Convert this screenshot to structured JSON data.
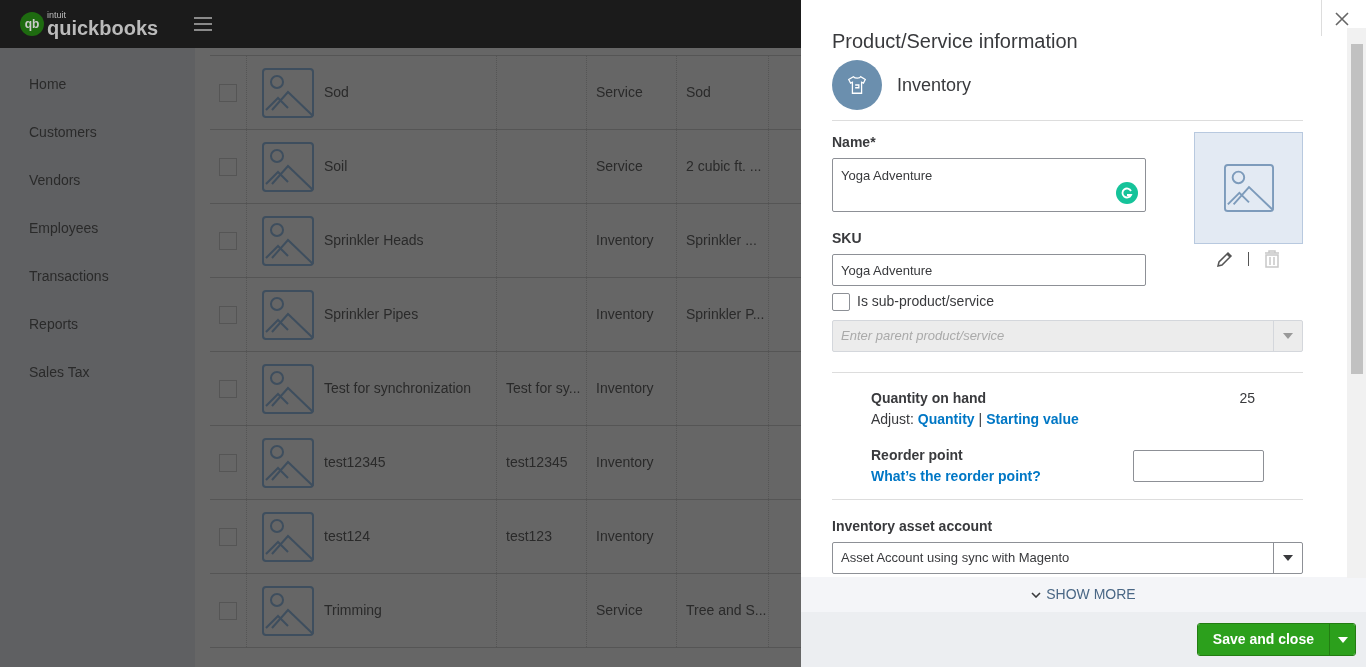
{
  "logo": {
    "mark": "qb",
    "small": "intuit",
    "name": "quickbooks"
  },
  "sidebar": {
    "items": [
      {
        "label": "Home"
      },
      {
        "label": "Customers"
      },
      {
        "label": "Vendors"
      },
      {
        "label": "Employees"
      },
      {
        "label": "Transactions"
      },
      {
        "label": "Reports"
      },
      {
        "label": "Sales Tax"
      }
    ]
  },
  "table": {
    "rows": [
      {
        "checked": false,
        "name": "Sod",
        "sku": "",
        "type": "Service",
        "description": "Sod"
      },
      {
        "checked": false,
        "name": "Soil",
        "sku": "",
        "type": "Service",
        "description": "2 cubic ft. ..."
      },
      {
        "checked": false,
        "name": "Sprinkler Heads",
        "sku": "",
        "type": "Inventory",
        "description": "Sprinkler ..."
      },
      {
        "checked": false,
        "name": "Sprinkler Pipes",
        "sku": "",
        "type": "Inventory",
        "description": "Sprinkler P..."
      },
      {
        "checked": false,
        "name": "Test for synchronization",
        "sku": "Test for sy...",
        "type": "Inventory",
        "description": ""
      },
      {
        "checked": false,
        "name": "test12345",
        "sku": "test12345",
        "type": "Inventory",
        "description": ""
      },
      {
        "checked": false,
        "name": "test124",
        "sku": "test123",
        "type": "Inventory",
        "description": ""
      },
      {
        "checked": false,
        "name": "Trimming",
        "sku": "",
        "type": "Service",
        "description": "Tree and S..."
      }
    ]
  },
  "panel": {
    "title": "Product/Service information",
    "item_type": "Inventory",
    "name_field": {
      "label": "Name*",
      "value": "Yoga Adventure"
    },
    "sku_field": {
      "label": "SKU",
      "value": "Yoga Adventure"
    },
    "sub_product": {
      "label": "Is sub-product/service",
      "checked": false
    },
    "parent_field": {
      "placeholder": "Enter parent product/service",
      "disabled": true
    },
    "quantity": {
      "label": "Quantity on hand",
      "value": "25",
      "adjust_label": "Adjust:",
      "links": [
        "Quantity",
        "Starting value"
      ],
      "separator": "|"
    },
    "reorder": {
      "label": "Reorder point",
      "link": "What’s the reorder point?"
    },
    "asset_account": {
      "label": "Inventory asset account",
      "value": "Asset Account using sync with Magento"
    },
    "show_more": "SHOW MORE",
    "save_button": "Save and close"
  }
}
